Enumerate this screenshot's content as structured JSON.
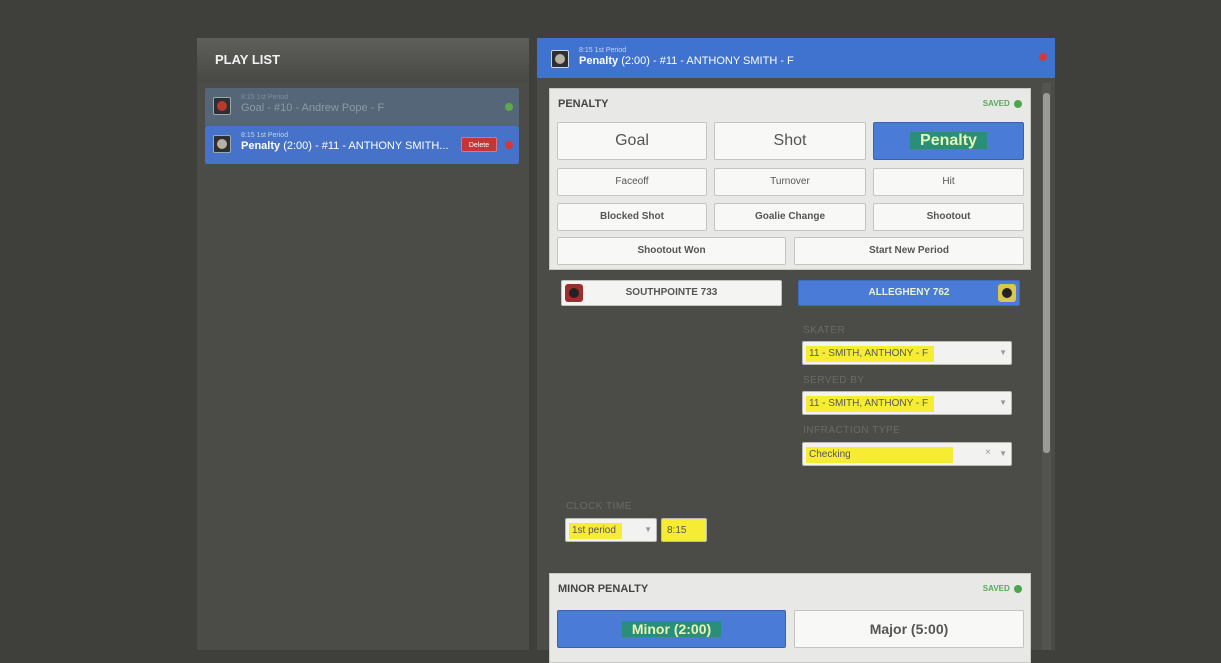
{
  "playlist": {
    "title": "PLAY LIST",
    "items": [
      {
        "small": "8:15 1st Period",
        "title": "Goal - #10 - Andrew Pope - F",
        "status_color": "#5fa84f"
      },
      {
        "small": "8:15 1st Period",
        "bold": "Penalty",
        "title_rest": " (2:00) - #11 - ANTHONY SMITH...",
        "delete_label": "Delete",
        "status_color": "#d23a3a"
      }
    ]
  },
  "detail": {
    "small": "8:15 1st Period",
    "bold": "Penalty",
    "title_rest": " (2:00) - #11 - ANTHONY SMITH - F"
  },
  "penalty_card": {
    "title": "PENALTY",
    "saved": "SAVED",
    "buttons": {
      "goal": "Goal",
      "shot": "Shot",
      "penalty": "Penalty",
      "faceoff": "Faceoff",
      "turnover": "Turnover",
      "hit": "Hit",
      "blocked_shot": "Blocked Shot",
      "goalie_change": "Goalie Change",
      "shootout": "Shootout",
      "shootout_won": "Shootout Won",
      "start_new_period": "Start New Period"
    }
  },
  "teams": {
    "home": "SOUTHPOINTE 733",
    "away": "ALLEGHENY 762"
  },
  "fields": {
    "skater_label": "SKATER",
    "skater_value": "11 - SMITH, ANTHONY - F",
    "served_by_label": "SERVED BY",
    "served_by_value": "11 - SMITH, ANTHONY - F",
    "infraction_label": "INFRACTION TYPE",
    "infraction_value": "Checking",
    "clock_label": "CLOCK TIME",
    "period_value": "1st period",
    "time_value": "8:15"
  },
  "minor_card": {
    "title": "MINOR PENALTY",
    "saved": "SAVED",
    "minor": "Minor (2:00)",
    "major": "Major (5:00)"
  }
}
